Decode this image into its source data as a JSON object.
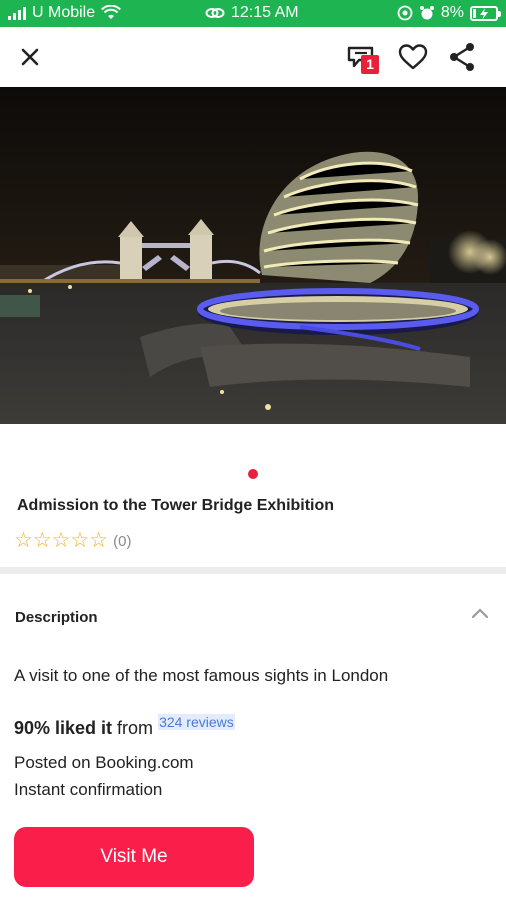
{
  "status_bar": {
    "carrier": "U Mobile",
    "time": "12:15 AM",
    "battery": "8%"
  },
  "top_bar": {
    "cart_count": "1"
  },
  "gallery": {
    "active_index": 0
  },
  "product": {
    "title": "Admission to the Tower Bridge Exhibition",
    "stars": "☆☆☆☆☆",
    "rating_count": "(0)"
  },
  "description": {
    "heading": "Description",
    "text": "A visit to one of the most famous sights in London",
    "liked_value": "90% liked it",
    "liked_from": " from ",
    "reviews_link": "324 reviews",
    "posted": "Posted on Booking.com",
    "confirmation": "Instant confirmation"
  },
  "cta": {
    "label": "Visit Me"
  },
  "colors": {
    "status_bar": "#1eb451",
    "accent": "#fa1e4a",
    "star": "#f2b01e",
    "link": "#4a7bd8"
  }
}
